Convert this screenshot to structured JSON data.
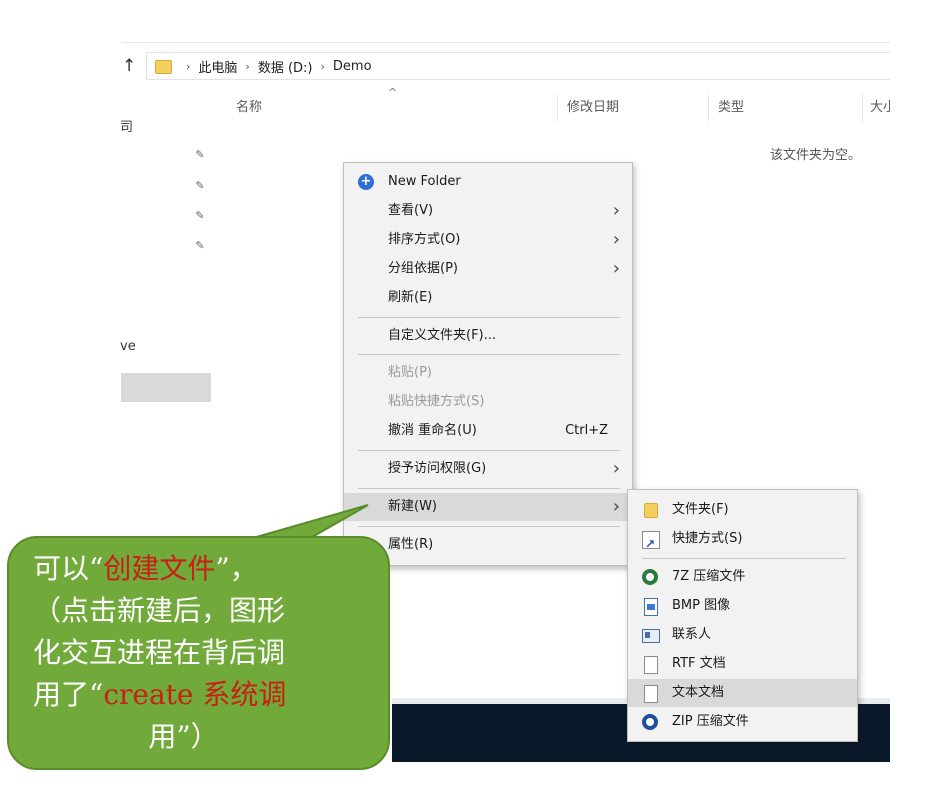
{
  "explorer": {
    "nav_up": "↑",
    "breadcrumb": [
      "此电脑",
      "数据 (D:)",
      "Demo"
    ],
    "breadcrumb_sep": "›",
    "columns": [
      "名称",
      "修改日期",
      "类型",
      "大小"
    ],
    "sort_caret": "^",
    "empty_message": "该文件夹为空。",
    "left_fragments": [
      "司",
      "ve"
    ],
    "pin_glyph": "✎"
  },
  "context_menu": {
    "items": [
      {
        "label": "New Folder",
        "icon": "plus-circle-icon"
      },
      {
        "label": "查看(V)",
        "submenu": true
      },
      {
        "label": "排序方式(O)",
        "submenu": true
      },
      {
        "label": "分组依据(P)",
        "submenu": true
      },
      {
        "label": "刷新(E)"
      },
      {
        "label": "自定义文件夹(F)..."
      },
      {
        "label": "粘贴(P)",
        "disabled": true
      },
      {
        "label": "粘贴快捷方式(S)",
        "disabled": true
      },
      {
        "label": "撤消 重命名(U)",
        "shortcut": "Ctrl+Z"
      },
      {
        "label": "授予访问权限(G)",
        "submenu": true
      },
      {
        "label": "新建(W)",
        "submenu": true,
        "highlighted": true
      },
      {
        "label": "属性(R)"
      }
    ],
    "arrow_glyph": "›"
  },
  "new_submenu": {
    "items": [
      {
        "label": "文件夹(F)",
        "icon": "folder-icon"
      },
      {
        "label": "快捷方式(S)",
        "icon": "shortcut-icon"
      },
      {
        "label": "7Z 压缩文件",
        "icon": "7z-archive-icon"
      },
      {
        "label": "BMP 图像",
        "icon": "bmp-image-icon"
      },
      {
        "label": "联系人",
        "icon": "contact-icon"
      },
      {
        "label": "RTF 文档",
        "icon": "rtf-document-icon"
      },
      {
        "label": "文本文档",
        "icon": "text-document-icon",
        "highlighted": true
      },
      {
        "label": "ZIP 压缩文件",
        "icon": "zip-archive-icon"
      }
    ]
  },
  "annotation": {
    "line1_a": "可以“",
    "line1_red": "创建文件",
    "line1_b": "”，",
    "line2": "（点击新建后，图形",
    "line3": "化交互进程在背后调",
    "line4_a": "用了“",
    "line4_red": "create",
    "line4_red2": " 系统调",
    "line5": "用”）",
    "bg_color": "#71a93a",
    "highlight_color": "#c82015"
  }
}
